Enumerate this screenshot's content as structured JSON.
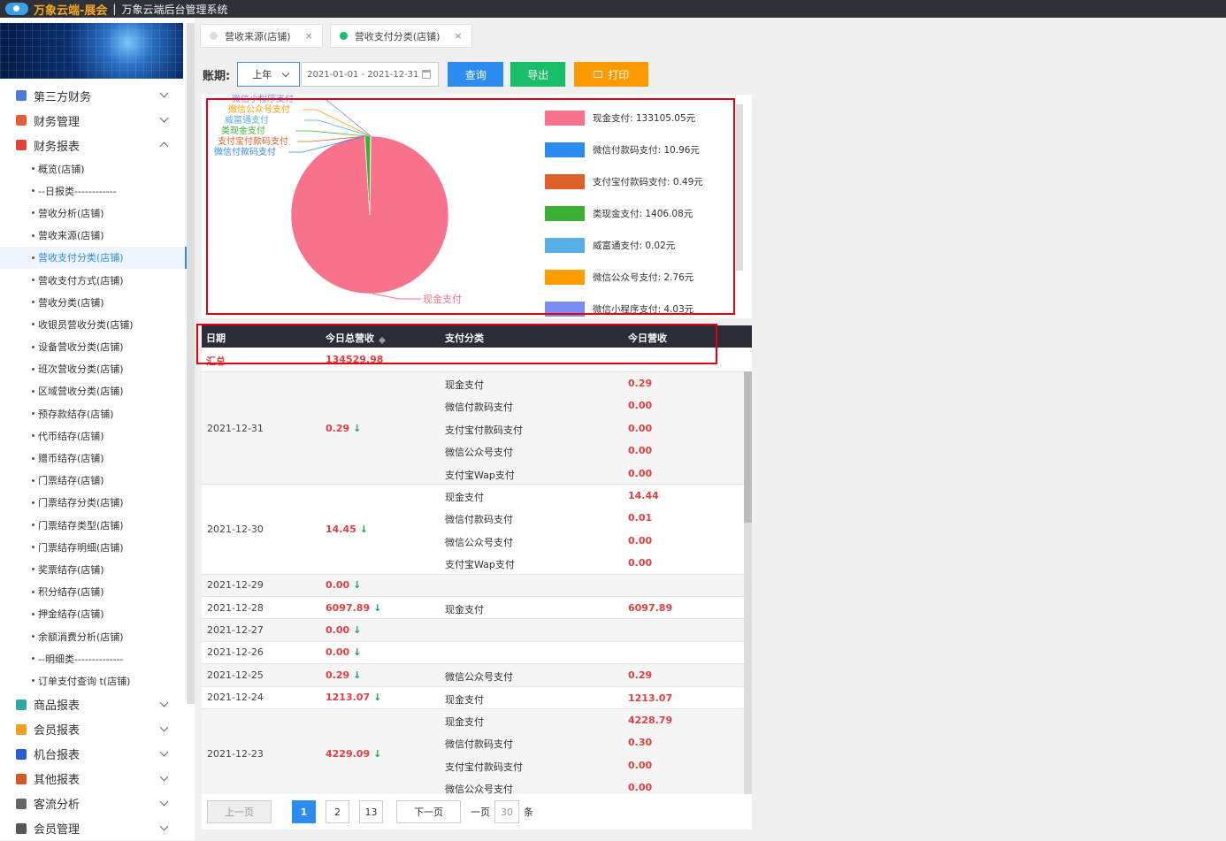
{
  "header": {
    "brand": "万象云端-展会",
    "separator": "|",
    "system_name": "万象云端后台管理系统"
  },
  "sidebar": {
    "groups_top": [
      {
        "label": "第三方财务",
        "color": "#4a7bd8",
        "expanded": false
      },
      {
        "label": "财务管理",
        "color": "#e0603a",
        "expanded": false
      },
      {
        "label": "财务报表",
        "color": "#e0453a",
        "expanded": true
      }
    ],
    "sub_items": [
      "概览(店铺)",
      "--日报类------------",
      "营收分析(店铺)",
      "营收来源(店铺)",
      "营收支付分类(店铺)",
      "营收支付方式(店铺)",
      "营收分类(店铺)",
      "收银员营收分类(店铺)",
      "设备营收分类(店铺)",
      "班次营收分类(店铺)",
      "区域营收分类(店铺)",
      "预存款结存(店铺)",
      "代币结存(店铺)",
      "赠币结存(店铺)",
      "门票结存(店铺)",
      "门票结存分类(店铺)",
      "门票结存类型(店铺)",
      "门票结存明细(店铺)",
      "奖票结存(店铺)",
      "积分结存(店铺)",
      "押金结存(店铺)",
      "余额消费分析(店铺)",
      "--明细类--------------",
      "订单支付查询 t(店铺)"
    ],
    "active_sub": "营收支付分类(店铺)",
    "groups_bottom": [
      {
        "label": "商品报表",
        "color": "#2aa8a0"
      },
      {
        "label": "会员报表",
        "color": "#f0a020"
      },
      {
        "label": "机台报表",
        "color": "#2a5fd0"
      },
      {
        "label": "其他报表",
        "color": "#d05a2a"
      },
      {
        "label": "客流分析",
        "color": "#666666"
      },
      {
        "label": "会员管理",
        "color": "#555555"
      }
    ]
  },
  "tabs": [
    {
      "label": "营收来源(店铺)",
      "active": false,
      "close": "×"
    },
    {
      "label": "营收支付分类(店铺)",
      "active": true,
      "close": "×"
    }
  ],
  "filter": {
    "label": "账期:",
    "period": "上年",
    "date_range": "2021-01-01 - 2021-12-31",
    "query": "查询",
    "export": "导出",
    "print": "打印"
  },
  "chart_data": {
    "type": "pie",
    "unit": "元",
    "slices": [
      {
        "name": "现金支付",
        "value": 133105.05,
        "color": "#f7728a"
      },
      {
        "name": "微信付款码支付",
        "value": 10.96,
        "color": "#2d8cf0"
      },
      {
        "name": "支付宝付款码支付",
        "value": 0.49,
        "color": "#e0602a"
      },
      {
        "name": "类现金支付",
        "value": 1406.08,
        "color": "#3cb034"
      },
      {
        "name": "威富通支付",
        "value": 0.02,
        "color": "#5aaee8"
      },
      {
        "name": "微信公众号支付",
        "value": 2.76,
        "color": "#ff9c00"
      },
      {
        "name": "微信小程序支付",
        "value": 4.03,
        "color": "#7a8cf0"
      }
    ],
    "legend_text": [
      "现金支付: 133105.05元",
      "微信付款码支付: 10.96元",
      "支付宝付款码支付: 0.49元",
      "类现金支付: 1406.08元",
      "威富通支付: 0.02元",
      "微信公众号支付: 2.76元",
      "微信小程序支付: 4.03元"
    ],
    "legend_placement": "right"
  },
  "table": {
    "columns": [
      "日期",
      "今日总营收",
      "支付分类",
      "今日营收"
    ],
    "summary_label": "汇总",
    "summary_total": "134529.98",
    "rows": [
      {
        "date": "2021-12-31",
        "total": "0.29",
        "details": [
          [
            "现金支付",
            "0.29"
          ],
          [
            "微信付款码支付",
            "0.00"
          ],
          [
            "支付宝付款码支付",
            "0.00"
          ],
          [
            "微信公众号支付",
            "0.00"
          ],
          [
            "支付宝Wap支付",
            "0.00"
          ]
        ]
      },
      {
        "date": "2021-12-30",
        "total": "14.45",
        "details": [
          [
            "现金支付",
            "14.44"
          ],
          [
            "微信付款码支付",
            "0.01"
          ],
          [
            "微信公众号支付",
            "0.00"
          ],
          [
            "支付宝Wap支付",
            "0.00"
          ]
        ]
      },
      {
        "date": "2021-12-29",
        "total": "0.00",
        "details": []
      },
      {
        "date": "2021-12-28",
        "total": "6097.89",
        "details": [
          [
            "现金支付",
            "6097.89"
          ]
        ]
      },
      {
        "date": "2021-12-27",
        "total": "0.00",
        "details": []
      },
      {
        "date": "2021-12-26",
        "total": "0.00",
        "details": []
      },
      {
        "date": "2021-12-25",
        "total": "0.29",
        "details": [
          [
            "微信公众号支付",
            "0.29"
          ]
        ]
      },
      {
        "date": "2021-12-24",
        "total": "1213.07",
        "details": [
          [
            "现金支付",
            "1213.07"
          ]
        ]
      },
      {
        "date": "2021-12-23",
        "total": "4229.09",
        "details": [
          [
            "现金支付",
            "4228.79"
          ],
          [
            "微信付款码支付",
            "0.30"
          ],
          [
            "支付宝付款码支付",
            "0.00"
          ],
          [
            "微信公众号支付",
            "0.00"
          ]
        ]
      }
    ]
  },
  "pager": {
    "prev": "上一页",
    "pages": [
      "1",
      "2",
      "13"
    ],
    "current": "1",
    "next": "下一页",
    "per_page_prefix": "一页",
    "per_page": "30",
    "per_page_suffix": "条"
  }
}
